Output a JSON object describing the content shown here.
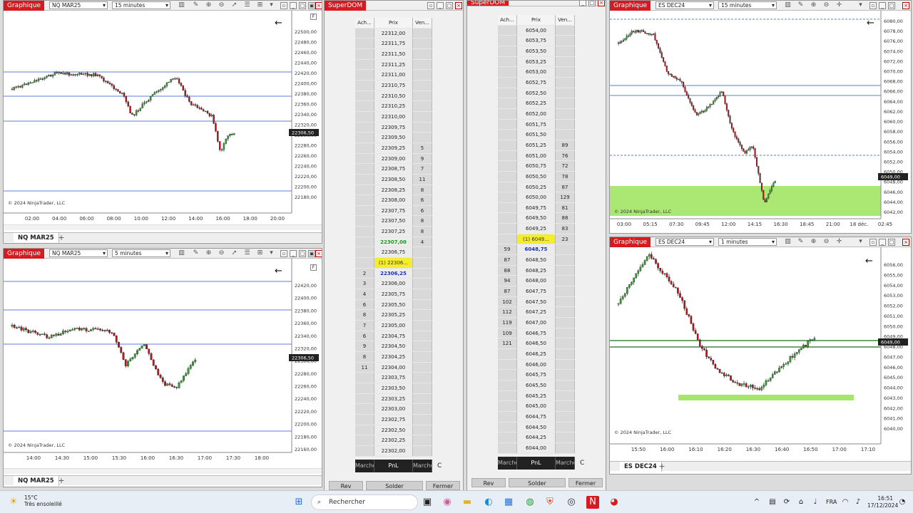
{
  "windows": {
    "chart_tl": {
      "title": "Graphique",
      "instrument": "NQ MAR25",
      "interval": "15 minutes",
      "tab": "NQ MAR25",
      "copyright": "© 2024 NinjaTrader, LLC",
      "price_marker": "22306,50",
      "price_ticks": [
        "22500,00",
        "22480,00",
        "22460,00",
        "22440,00",
        "22420,00",
        "22400,00",
        "22380,00",
        "22360,00",
        "22340,00",
        "22320,00",
        "22300,00",
        "22280,00",
        "22260,00",
        "22240,00",
        "22220,00",
        "22200,00",
        "22180,00"
      ],
      "time_ticks": [
        "02:00",
        "04:00",
        "06:00",
        "08:00",
        "10:00",
        "12:00",
        "14:00",
        "16:00",
        "18:00",
        "20:00"
      ]
    },
    "chart_bl": {
      "title": "Graphique",
      "instrument": "NQ MAR25",
      "interval": "5 minutes",
      "tab": "NQ MAR25",
      "copyright": "© 2024 NinjaTrader, LLC",
      "price_marker": "22306,50",
      "price_ticks": [
        "22420,00",
        "22400,00",
        "22380,00",
        "22360,00",
        "22340,00",
        "22320,00",
        "22300,00",
        "22280,00",
        "22260,00",
        "22240,00",
        "22220,00",
        "22200,00",
        "22180,00",
        "22160,00"
      ],
      "time_ticks": [
        "14:00",
        "14:30",
        "15:00",
        "15:30",
        "16:00",
        "16:30",
        "17:00",
        "17:30",
        "18:00"
      ]
    },
    "chart_tr": {
      "title": "Graphique",
      "instrument": "ES DEC24",
      "interval": "15 minutes",
      "copyright": "© 2024 NinjaTrader, LLC",
      "price_marker": "6049,00",
      "price_ticks": [
        "6080,00",
        "6078,00",
        "6076,00",
        "6074,00",
        "6072,00",
        "6070,00",
        "6068,00",
        "6066,00",
        "6064,00",
        "6062,00",
        "6060,00",
        "6058,00",
        "6056,00",
        "6054,00",
        "6052,00",
        "6050,00",
        "6048,00",
        "6046,00",
        "6044,00",
        "6042,00"
      ],
      "time_ticks": [
        "03:00",
        "05:15",
        "07:30",
        "09:45",
        "12:00",
        "14:15",
        "16:30",
        "18:45",
        "21:00",
        "18 déc.",
        "02:45"
      ]
    },
    "chart_br": {
      "title": "Graphique",
      "instrument": "ES DEC24",
      "interval": "1 minutes",
      "tab": "ES DEC24",
      "copyright": "© 2024 NinjaTrader, LLC",
      "price_marker": "6049,00",
      "price_ticks": [
        "6056,00",
        "6055,00",
        "6054,00",
        "6053,00",
        "6052,00",
        "6051,00",
        "6050,00",
        "6049,00",
        "6048,00",
        "6047,00",
        "6046,00",
        "6045,00",
        "6044,00",
        "6043,00",
        "6042,00",
        "6041,00",
        "6040,00"
      ],
      "time_ticks": [
        "15:50",
        "16:00",
        "16:10",
        "16:20",
        "16:30",
        "16:40",
        "16:50",
        "17:00",
        "17:10"
      ]
    }
  },
  "dom1": {
    "title": "SuperDOM",
    "headers": {
      "bid": "Ach...",
      "price": "Prix",
      "ask": "Ven..."
    },
    "rows": [
      {
        "b": "",
        "p": "22312,00",
        "a": ""
      },
      {
        "b": "",
        "p": "22311,75",
        "a": ""
      },
      {
        "b": "",
        "p": "22311,50",
        "a": ""
      },
      {
        "b": "",
        "p": "22311,25",
        "a": ""
      },
      {
        "b": "",
        "p": "22311,00",
        "a": ""
      },
      {
        "b": "",
        "p": "22310,75",
        "a": ""
      },
      {
        "b": "",
        "p": "22310,50",
        "a": ""
      },
      {
        "b": "",
        "p": "22310,25",
        "a": ""
      },
      {
        "b": "",
        "p": "22310,00",
        "a": ""
      },
      {
        "b": "",
        "p": "22309,75",
        "a": ""
      },
      {
        "b": "",
        "p": "22309,50",
        "a": ""
      },
      {
        "b": "",
        "p": "22309,25",
        "a": "5"
      },
      {
        "b": "",
        "p": "22309,00",
        "a": "9"
      },
      {
        "b": "",
        "p": "22308,75",
        "a": "7"
      },
      {
        "b": "",
        "p": "22308,50",
        "a": "11"
      },
      {
        "b": "",
        "p": "22308,25",
        "a": "8"
      },
      {
        "b": "",
        "p": "22308,00",
        "a": "6"
      },
      {
        "b": "",
        "p": "22307,75",
        "a": "6"
      },
      {
        "b": "",
        "p": "22307,50",
        "a": "8"
      },
      {
        "b": "",
        "p": "22307,25",
        "a": "8"
      },
      {
        "b": "",
        "p": "22307,00",
        "a": "4",
        "k": "last"
      },
      {
        "b": "",
        "p": "22306,75",
        "a": ""
      },
      {
        "b": "",
        "p": "(1) 22306...",
        "a": "",
        "k": "pos"
      },
      {
        "b": "2",
        "p": "22306,25",
        "a": "",
        "k": "cur"
      },
      {
        "b": "3",
        "p": "22306,00",
        "a": ""
      },
      {
        "b": "4",
        "p": "22305,75",
        "a": ""
      },
      {
        "b": "6",
        "p": "22305,50",
        "a": ""
      },
      {
        "b": "8",
        "p": "22305,25",
        "a": ""
      },
      {
        "b": "7",
        "p": "22305,00",
        "a": ""
      },
      {
        "b": "6",
        "p": "22304,75",
        "a": ""
      },
      {
        "b": "9",
        "p": "22304,50",
        "a": ""
      },
      {
        "b": "8",
        "p": "22304,25",
        "a": ""
      },
      {
        "b": "11",
        "p": "22304,00",
        "a": ""
      },
      {
        "b": "",
        "p": "22303,75",
        "a": ""
      },
      {
        "b": "",
        "p": "22303,50",
        "a": ""
      },
      {
        "b": "",
        "p": "22303,25",
        "a": ""
      },
      {
        "b": "",
        "p": "22303,00",
        "a": ""
      },
      {
        "b": "",
        "p": "22302,75",
        "a": ""
      },
      {
        "b": "",
        "p": "22302,50",
        "a": ""
      },
      {
        "b": "",
        "p": "22302,25",
        "a": ""
      },
      {
        "b": "",
        "p": "22302,00",
        "a": ""
      }
    ],
    "footer": {
      "left": "Marche",
      "mid": "PnL",
      "right": "Marche",
      "c": "C"
    },
    "buttons": {
      "rev": "Rev",
      "solder": "Solder",
      "fermer": "Fermer"
    }
  },
  "dom2": {
    "title": "SuperDOM",
    "headers": {
      "bid": "Ach...",
      "price": "Prix",
      "ask": "Ven..."
    },
    "rows": [
      {
        "b": "",
        "p": "6054,00",
        "a": ""
      },
      {
        "b": "",
        "p": "6053,75",
        "a": ""
      },
      {
        "b": "",
        "p": "6053,50",
        "a": ""
      },
      {
        "b": "",
        "p": "6053,25",
        "a": ""
      },
      {
        "b": "",
        "p": "6053,00",
        "a": ""
      },
      {
        "b": "",
        "p": "6052,75",
        "a": ""
      },
      {
        "b": "",
        "p": "6052,50",
        "a": ""
      },
      {
        "b": "",
        "p": "6052,25",
        "a": ""
      },
      {
        "b": "",
        "p": "6052,00",
        "a": ""
      },
      {
        "b": "",
        "p": "6051,75",
        "a": ""
      },
      {
        "b": "",
        "p": "6051,50",
        "a": ""
      },
      {
        "b": "",
        "p": "6051,25",
        "a": "89"
      },
      {
        "b": "",
        "p": "6051,00",
        "a": "76"
      },
      {
        "b": "",
        "p": "6050,75",
        "a": "72"
      },
      {
        "b": "",
        "p": "6050,50",
        "a": "78"
      },
      {
        "b": "",
        "p": "6050,25",
        "a": "87"
      },
      {
        "b": "",
        "p": "6050,00",
        "a": "129"
      },
      {
        "b": "",
        "p": "6049,75",
        "a": "81"
      },
      {
        "b": "",
        "p": "6049,50",
        "a": "88"
      },
      {
        "b": "",
        "p": "6049,25",
        "a": "83"
      },
      {
        "b": "",
        "p": "(1) 6049...",
        "a": "23",
        "k": "pos"
      },
      {
        "b": "59",
        "p": "6048,75",
        "a": "",
        "k": "cur"
      },
      {
        "b": "87",
        "p": "6048,50",
        "a": ""
      },
      {
        "b": "88",
        "p": "6048,25",
        "a": ""
      },
      {
        "b": "94",
        "p": "6048,00",
        "a": ""
      },
      {
        "b": "87",
        "p": "6047,75",
        "a": ""
      },
      {
        "b": "102",
        "p": "6047,50",
        "a": ""
      },
      {
        "b": "112",
        "p": "6047,25",
        "a": ""
      },
      {
        "b": "119",
        "p": "6047,00",
        "a": ""
      },
      {
        "b": "109",
        "p": "6046,75",
        "a": ""
      },
      {
        "b": "121",
        "p": "6046,50",
        "a": ""
      },
      {
        "b": "",
        "p": "6046,25",
        "a": ""
      },
      {
        "b": "",
        "p": "6046,00",
        "a": ""
      },
      {
        "b": "",
        "p": "6045,75",
        "a": ""
      },
      {
        "b": "",
        "p": "6045,50",
        "a": ""
      },
      {
        "b": "",
        "p": "6045,25",
        "a": ""
      },
      {
        "b": "",
        "p": "6045,00",
        "a": ""
      },
      {
        "b": "",
        "p": "6044,75",
        "a": ""
      },
      {
        "b": "",
        "p": "6044,50",
        "a": ""
      },
      {
        "b": "",
        "p": "6044,25",
        "a": ""
      },
      {
        "b": "",
        "p": "6044,00",
        "a": ""
      }
    ],
    "footer": {
      "left": "Marche",
      "mid": "PnL",
      "right": "Marche",
      "c": "C"
    },
    "buttons": {
      "rev": "Rev",
      "solder": "Solder",
      "fermer": "Fermer"
    }
  },
  "taskbar": {
    "temp": "15°C",
    "weather": "Très ensoleillé",
    "search": "Rechercher",
    "lang": "FRA",
    "time": "16:51",
    "date": "17/12/2024"
  },
  "colors": {
    "up": "#2eaa2e",
    "down": "#c0141c",
    "hline": "#5b7fd6",
    "zone": "#9be35b",
    "accent": "#d71920"
  }
}
